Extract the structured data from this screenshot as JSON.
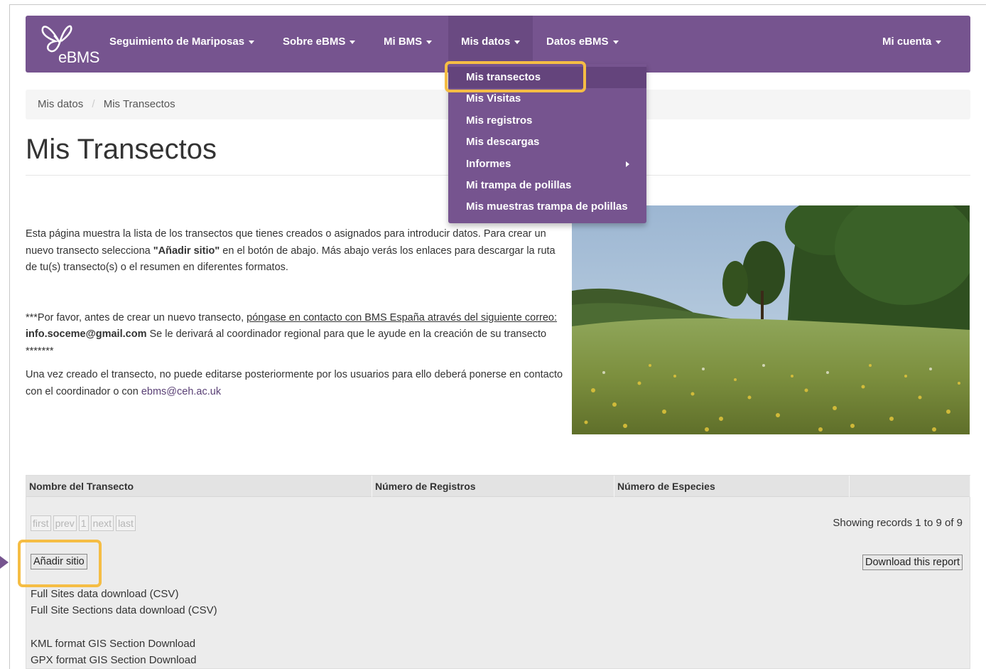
{
  "navbar": {
    "logo_text": "eBMS",
    "items": [
      {
        "label": "Seguimiento de Mariposas"
      },
      {
        "label": "Sobre eBMS"
      },
      {
        "label": "Mi BMS"
      },
      {
        "label": "Mis datos"
      },
      {
        "label": "Datos eBMS"
      }
    ],
    "account_label": "Mi cuenta",
    "accent_color": "#76548f"
  },
  "dropdown": {
    "items": [
      {
        "label": "Mis transectos"
      },
      {
        "label": "Mis Visitas"
      },
      {
        "label": "Mis registros"
      },
      {
        "label": "Mis descargas"
      },
      {
        "label": "Informes"
      },
      {
        "label": "Mi trampa de polillas"
      },
      {
        "label": "Mis muestras trampa de polillas"
      }
    ]
  },
  "breadcrumb": {
    "parent": "Mis datos",
    "separator": "/",
    "current": "Mis Transectos"
  },
  "page_title": "Mis Transectos",
  "intro": {
    "p1": "Esta página muestra la lista de los transectos que tienes creados o asignados para introducir datos. Para crear un nuevo transecto selecciona ",
    "p1_bold": "\"Añadir sitio\"",
    "p1_end": " en el botón de abajo. Más abajo verás los enlaces para descargar la ruta de tu(s) transecto(s) o el resumen en diferentes formatos.",
    "p2_start": "***Por favor, antes de crear un nuevo transecto, ",
    "p2_underline": "póngase en contacto con BMS España através del siguiente correo:",
    "p2_email": " info.soceme@gmail.com",
    "p2_end": " Se le derivará al coordinador regional para que le ayude en la creación de su transecto *******",
    "p3": "Una vez creado el transecto, no puede editarse posteriormente por los usuarios para ello deberá ponerse en contacto con el coordinador o con ",
    "p3_link": "ebms@ceh.ac.uk"
  },
  "table": {
    "columns": [
      "Nombre del Transecto",
      "Número de Registros",
      "Número de Especies",
      ""
    ],
    "pager": [
      "first",
      "prev",
      "1",
      "next",
      "last"
    ],
    "records_info": "Showing records 1 to 9 of 9",
    "add_site_label": "Añadir sitio",
    "download_report_label": "Download this report",
    "downloads": [
      "Full Sites data download (CSV)",
      "Full Site Sections data download (CSV)",
      "KML format GIS Section Download",
      "GPX format GIS Section Download"
    ]
  },
  "highlight_color": "#f5bd44"
}
